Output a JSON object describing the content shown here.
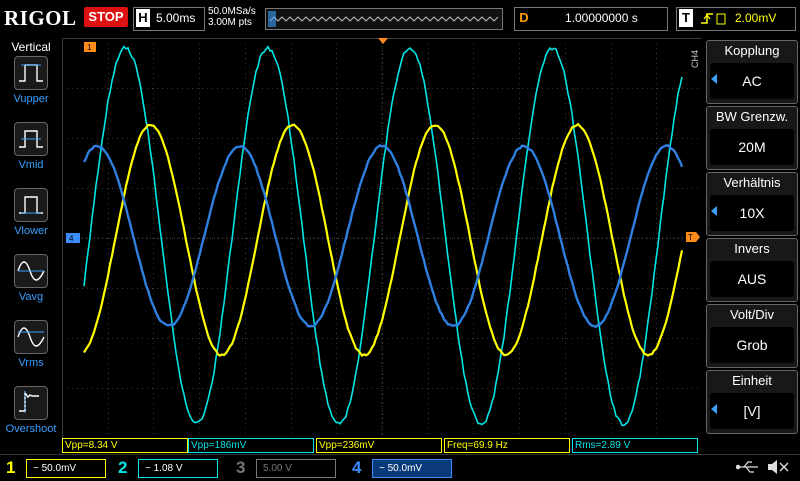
{
  "topbar": {
    "brand": "RIGOL",
    "run_state": "STOP",
    "timebase_letter": "H",
    "timebase": "5.00ms",
    "sample_rate": "50.0MSa/s",
    "memory_depth": "3.00M pts",
    "delay_letter": "D",
    "delay": "1.00000000 s",
    "trigger_letter": "T",
    "trigger_level": "2.00mV"
  },
  "left_menu": {
    "title": "Vertical",
    "items": [
      {
        "label": "Vupper",
        "icon": "vupper-icon"
      },
      {
        "label": "Vmid",
        "icon": "vmid-icon"
      },
      {
        "label": "Vlower",
        "icon": "vlower-icon"
      },
      {
        "label": "Vavg",
        "icon": "vavg-icon"
      },
      {
        "label": "Vrms",
        "icon": "vrms-icon"
      },
      {
        "label": "Overshoot",
        "icon": "overshoot-icon"
      }
    ]
  },
  "right_menu": {
    "channel_tag": "CH4",
    "items": [
      {
        "title": "Kopplung",
        "value": "AC"
      },
      {
        "title": "BW Grenzw.",
        "value": "20M"
      },
      {
        "title": "Verhältnis",
        "value": "10X"
      },
      {
        "title": "Invers",
        "value": "AUS"
      },
      {
        "title": "Volt/Div",
        "value": "Grob"
      },
      {
        "title": "Einheit",
        "value": "[V]"
      }
    ]
  },
  "measurements": [
    {
      "text": "Vpp=8.34 V",
      "color": "#ffff00"
    },
    {
      "text": "Vpp=186mV",
      "color": "#00e5e5"
    },
    {
      "text": "Vpp=236mV",
      "color": "#ffff00"
    },
    {
      "text": "Freq=69.9 Hz",
      "color": "#ffff00"
    },
    {
      "text": "Rms=2.89 V",
      "color": "#00e5e5"
    }
  ],
  "channels": [
    {
      "num": "1",
      "value": "~ 50.0mV",
      "color": "#ffff00"
    },
    {
      "num": "2",
      "value": "~ 1.08 V",
      "color": "#00e5e5"
    },
    {
      "num": "3",
      "value": "5.00 V",
      "color": "#777777"
    },
    {
      "num": "4",
      "value": "~ 50.0mV",
      "color": "#3a8cff"
    }
  ],
  "markers": {
    "ch1": "1",
    "ch4": "4"
  },
  "colors": {
    "ch1": "#ffff00",
    "ch2": "#00e5e5",
    "ch4": "#2f7fe0",
    "trigger": "#ff8c1a",
    "accent": "#3aa0ff"
  }
}
